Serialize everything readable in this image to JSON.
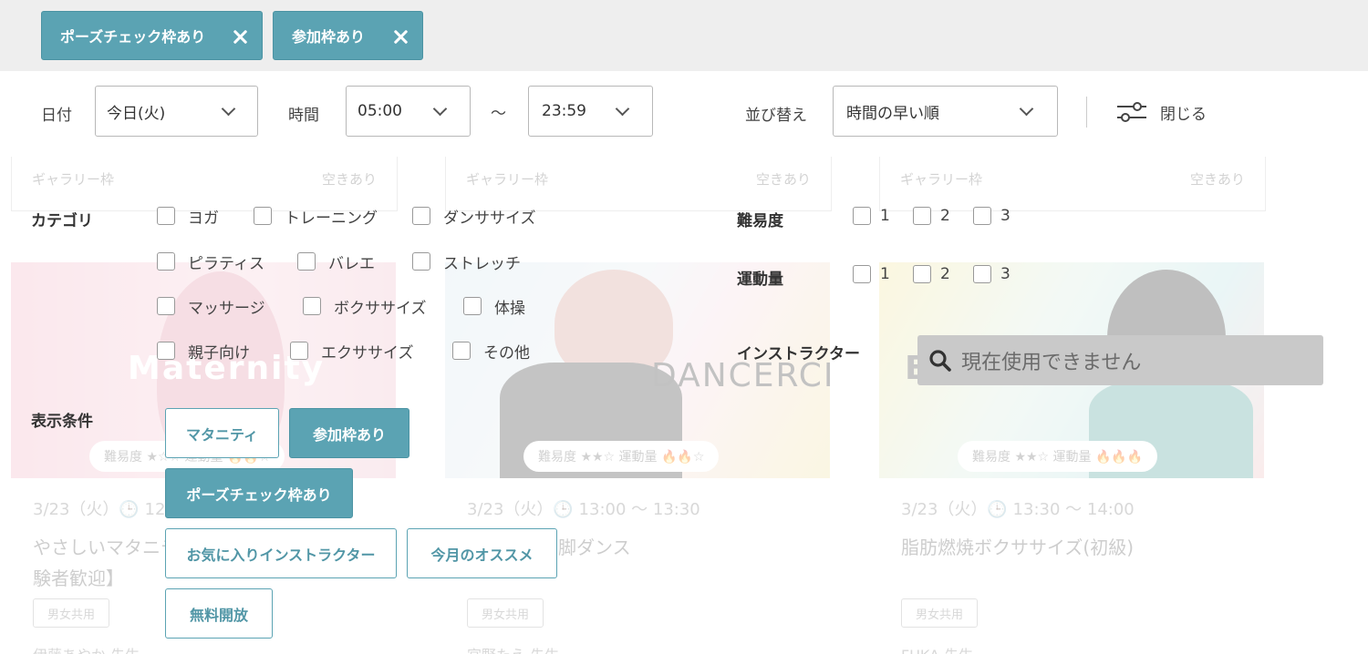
{
  "active_chips": [
    {
      "label": "ポーズチェック枠あり"
    },
    {
      "label": "参加枠あり"
    }
  ],
  "filters": {
    "date_label": "日付",
    "date_value": "今日(火)",
    "time_label": "時間",
    "time_from": "05:00",
    "time_sep": "〜",
    "time_to": "23:59",
    "sort_label": "並び替え",
    "sort_value": "時間の早い順",
    "close_label": "閉じる"
  },
  "panel": {
    "category_label": "カテゴリ",
    "categories": [
      "ヨガ",
      "トレーニング",
      "ダンササイズ",
      "ピラティス",
      "バレエ",
      "ストレッチ",
      "マッサージ",
      "ボクササイズ",
      "体操",
      "親子向け",
      "エクササイズ",
      "その他"
    ],
    "difficulty_label": "難易度",
    "difficulty_options": [
      "1",
      "2",
      "3"
    ],
    "activity_label": "運動量",
    "activity_options": [
      "1",
      "2",
      "3"
    ],
    "instructor_label": "インストラクター",
    "instructor_placeholder": "現在使用できません",
    "display_label": "表示条件",
    "conditions": [
      {
        "label": "マタニティ",
        "active": false
      },
      {
        "label": "参加枠あり",
        "active": true
      },
      {
        "label": "ポーズチェック枠あり",
        "active": true
      },
      {
        "label": "お気に入りインストラクター",
        "active": false
      },
      {
        "label": "今月のオススメ",
        "active": false
      },
      {
        "label": "無料開放",
        "active": false
      }
    ]
  },
  "background_cards": [
    {
      "gallery": "ギャラリー枠",
      "availability": "空きあり",
      "image_text": "Maternity",
      "pill": "難易度 ★☆☆  運動量 🔥🔥☆",
      "date": "3/23（火）🕒 12",
      "title_line1": "やさしいマタニテ",
      "title_line2": "験者歓迎】",
      "tag": "男女共用",
      "teacher": "伊藤あやか 先生"
    },
    {
      "gallery": "ギャラリー枠",
      "availability": "空きあり",
      "image_text": "DANCERCISE",
      "pill": "難易度 ★★☆  運動量 🔥🔥☆",
      "date": "3/23（火）🕒 13:00 〜 13:30",
      "title_line1": "脚ダンス",
      "title_line2": "",
      "tag": "男女共用",
      "teacher": "宮野たえ 先生"
    },
    {
      "gallery": "ギャラリー枠",
      "availability": "空きあり",
      "image_text": "B",
      "pill": "難易度 ★★☆  運動量 🔥🔥🔥",
      "date": "3/23（火）🕒 13:30 〜 14:00",
      "title_line1": "脂肪燃焼ボクササイズ(初級)",
      "title_line2": "",
      "tag": "男女共用",
      "teacher": "FUKA 先生"
    }
  ],
  "colors": {
    "accent": "#5ba3b3",
    "chip_bar": "#eeeeee",
    "search_disabled": "#c9c9c9"
  }
}
